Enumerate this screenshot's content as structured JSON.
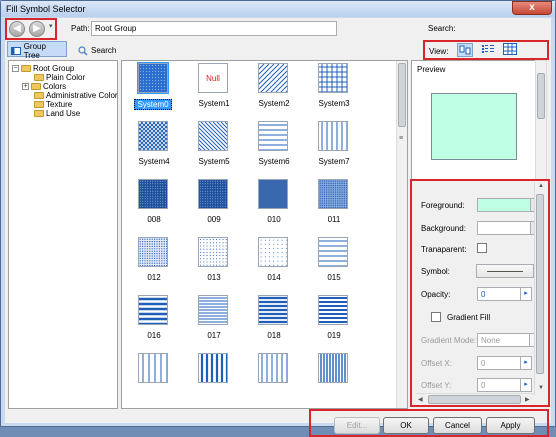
{
  "window": {
    "title": "Fill Symbol Selector",
    "close_glyph": "x"
  },
  "pathbar": {
    "path_label": "Path:",
    "path_value": "Root Group",
    "search_label": "Search:"
  },
  "toolbar": {
    "group_tree_label": "Group Tree",
    "search_label": "Search",
    "view_label": "View:"
  },
  "tree": {
    "root": "Root Group",
    "items": [
      "Plain Color",
      "Colors",
      "Administrative Color",
      "Texture",
      "Land Use"
    ]
  },
  "gallery": {
    "symbols": [
      {
        "label": "System0",
        "pattern": "solid-dots-blue",
        "selected": true
      },
      {
        "label": "System1",
        "pattern": "null",
        "null_text": "Null"
      },
      {
        "label": "System2",
        "pattern": "diag-lines"
      },
      {
        "label": "System3",
        "pattern": "grid"
      },
      {
        "label": "System4",
        "pattern": "cross-hatch"
      },
      {
        "label": "System5",
        "pattern": "diag-lines-fine"
      },
      {
        "label": "System6",
        "pattern": "horizontal-lines"
      },
      {
        "label": "System7",
        "pattern": "vertical-lines"
      },
      {
        "label": "008",
        "pattern": "dense-dots-dark"
      },
      {
        "label": "009",
        "pattern": "dense-dots-dark"
      },
      {
        "label": "010",
        "pattern": "dense-vertical-dark"
      },
      {
        "label": "011",
        "pattern": "dense-dots-light"
      },
      {
        "label": "012",
        "pattern": "light-dots"
      },
      {
        "label": "013",
        "pattern": "sparse-dots"
      },
      {
        "label": "014",
        "pattern": "very-sparse-dots"
      },
      {
        "label": "015",
        "pattern": "horizontal-lines"
      },
      {
        "label": "016",
        "pattern": "thick-horizontal"
      },
      {
        "label": "017",
        "pattern": "horizontal-fine"
      },
      {
        "label": "018",
        "pattern": "thick-horizontal-2"
      },
      {
        "label": "019",
        "pattern": "horizontal-medium"
      },
      {
        "label": "",
        "pattern": "vertical-lines-sparse"
      },
      {
        "label": "",
        "pattern": "vertical-lines-thick"
      },
      {
        "label": "",
        "pattern": "vertical-lines"
      },
      {
        "label": "",
        "pattern": "vertical-lines-dense"
      }
    ]
  },
  "preview": {
    "label": "Preview",
    "fill_color": "#bfffe3"
  },
  "properties": {
    "foreground_label": "Foreground:",
    "foreground_color": "#bfffe3",
    "background_label": "Background:",
    "background_color": "#ffffff",
    "transparent_label": "Tranaparent:",
    "symbol_label": "Symbol:",
    "opacity_label": "Opacity:",
    "opacity_value": "0",
    "percent_sign": "%",
    "gradient_fill_label": "Gradient Fill",
    "gradient_mode_label": "Gradient Mode:",
    "gradient_mode_value": "None",
    "offset_x_label": "Offset X:",
    "offset_x_value": "0",
    "offset_y_label": "Offset Y:",
    "offset_y_value": "0"
  },
  "buttons": {
    "edit": "Edit...",
    "ok": "OK",
    "cancel": "Cancel",
    "apply": "Apply"
  },
  "colors": {
    "accent": "#3399ff",
    "highlight_box": "#d9262c",
    "pattern_blue": "#1f5fb8"
  }
}
